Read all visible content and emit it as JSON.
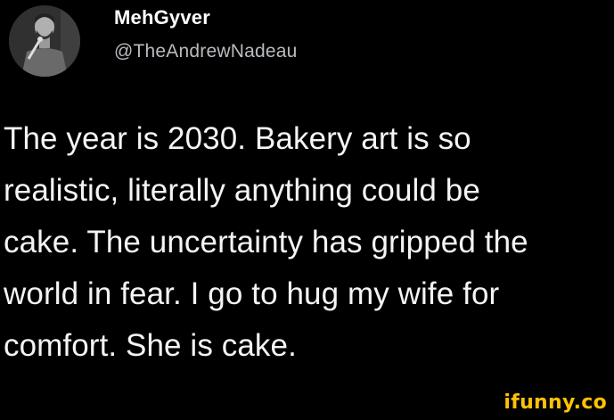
{
  "tweet": {
    "author": {
      "display_name": "MehGyver",
      "handle": "@TheAndrewNadeau",
      "avatar_icon": "profile-photo-icon"
    },
    "text_lines": [
      "The year is 2030. Bakery art is so",
      "realistic, literally anything could be",
      "cake. The uncertainty has gripped the",
      "world in fear. I go to hug my wife for",
      "comfort. She is cake."
    ]
  },
  "watermark": {
    "text": "ifunny.co"
  },
  "colors": {
    "background": "#000000",
    "text": "#f4f4f4",
    "handle": "#b8bcc0",
    "watermark": "#ffc107"
  }
}
